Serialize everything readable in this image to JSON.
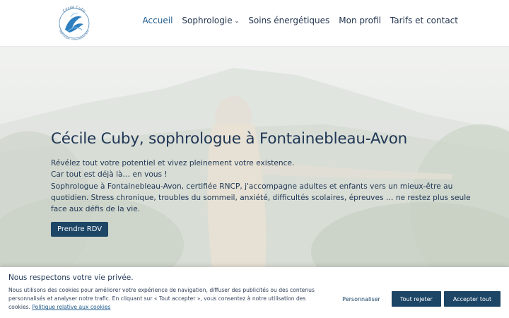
{
  "header": {
    "logo": {
      "name_text": "Cécile Cuby",
      "tagline_text": "Sophrologue · Fontainebleau-Avon"
    },
    "nav": [
      {
        "label": "Accueil",
        "active": true
      },
      {
        "label": "Sophrologie",
        "has_dropdown": true,
        "dropdown_icon": "chevron-down-icon"
      },
      {
        "label": "Soins énergétiques"
      },
      {
        "label": "Mon profil"
      },
      {
        "label": "Tarifs et contact"
      }
    ]
  },
  "hero": {
    "title": "Cécile Cuby, sophrologue à Fontainebleau-Avon",
    "lines": [
      "Révélez tout votre potentiel et vivez pleinement votre existence.",
      "Car tout est déjà là… en vous !",
      "Sophrologue à Fontainebleau-Avon, certifiée RNCP, j'accompagne adultes et enfants vers un mieux-être au quotidien. Stress chronique, troubles du sommeil, anxiété, difficultés scolaires, épreuves … ne restez plus seule face aux défis de la vie."
    ],
    "cta_label": "Prendre RDV"
  },
  "cookie_banner": {
    "title": "Nous respectons votre vie privée.",
    "text": "Nous utilisons des cookies pour améliorer votre expérience de navigation, diffuser des publicités ou des contenus personnalisés et analyser notre trafic. En cliquant sur « Tout accepter », vous consentez à notre utilisation des cookies.",
    "policy_link": "Politique relative aux cookies",
    "customize_label": "Personnaliser",
    "reject_label": "Tout rejeter",
    "accept_label": "Accepter tout"
  },
  "colors": {
    "primary": "#1c4566",
    "nav_text": "#24364f",
    "accent_blue": "#1f5b8c"
  }
}
